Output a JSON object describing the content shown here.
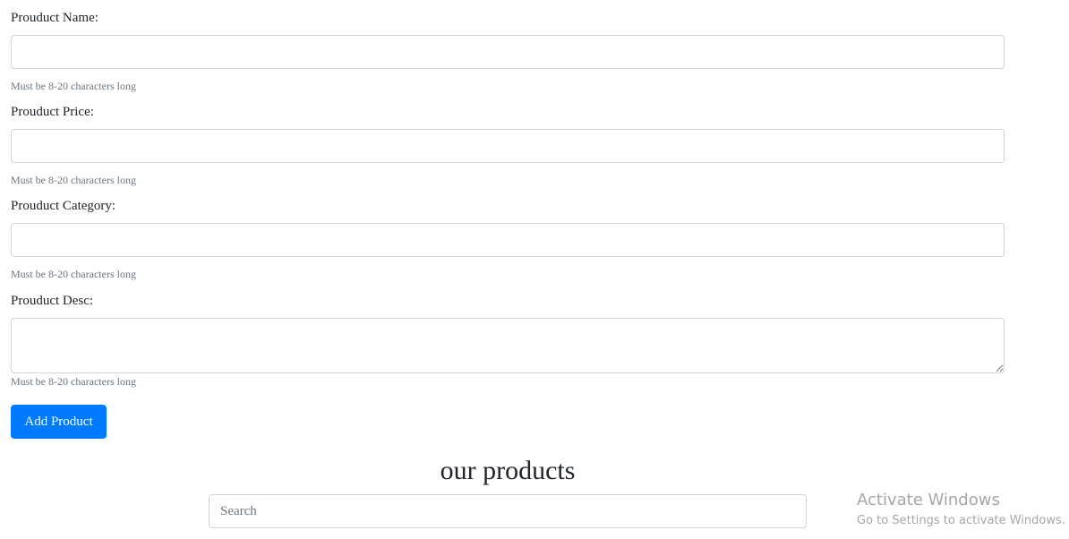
{
  "form": {
    "fields": [
      {
        "label": "Prouduct Name:",
        "value": "",
        "help": "Must be 8-20 characters long"
      },
      {
        "label": "Prouduct Price:",
        "value": "",
        "help": "Must be 8-20 characters long"
      },
      {
        "label": "Prouduct Category:",
        "value": "",
        "help": "Must be 8-20 characters long"
      },
      {
        "label": "Prouduct Desc:",
        "value": "",
        "help": "Must be 8-20 characters long"
      }
    ],
    "submit_label": "Add Product"
  },
  "products": {
    "title": "our products",
    "search": {
      "placeholder": "Search",
      "value": ""
    }
  },
  "watermark": {
    "title": "Activate Windows",
    "subtitle": "Go to Settings to activate Windows."
  },
  "colors": {
    "primary": "#007bff",
    "muted_text": "#6c757d",
    "input_border": "#ced4da"
  }
}
